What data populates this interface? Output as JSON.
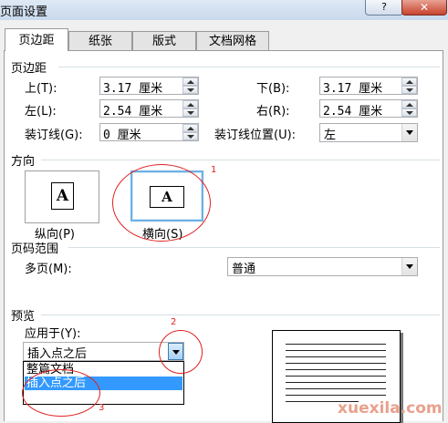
{
  "window": {
    "title": "页面设置",
    "help_glyph": "?",
    "close_glyph": "✕"
  },
  "tabs": [
    {
      "label": "页边距",
      "active": true
    },
    {
      "label": "纸张",
      "active": false
    },
    {
      "label": "版式",
      "active": false
    },
    {
      "label": "文档网格",
      "active": false
    }
  ],
  "margins": {
    "group_title": "页边距",
    "top_label": "上(T):",
    "top_value": "3.17 厘米",
    "bottom_label": "下(B):",
    "bottom_value": "3.17 厘米",
    "left_label": "左(L):",
    "left_value": "2.54 厘米",
    "right_label": "右(R):",
    "right_value": "2.54 厘米",
    "gutter_label": "装订线(G):",
    "gutter_value": "0 厘米",
    "gutter_pos_label": "装订线位置(U):",
    "gutter_pos_value": "左"
  },
  "orientation": {
    "group_title": "方向",
    "portrait_label": "纵向(P)",
    "landscape_label": "横向(S)",
    "glyph": "A",
    "selected": "landscape"
  },
  "pages": {
    "group_title": "页码范围",
    "multiple_label": "多页(M):",
    "multiple_value": "普通"
  },
  "preview": {
    "group_title": "预览",
    "apply_label": "应用于(Y):",
    "apply_value": "插入点之后",
    "apply_options": [
      "整篇文档",
      "插入点之后"
    ],
    "apply_selected_index": 1
  },
  "annotations": [
    "1",
    "2",
    "3"
  ],
  "watermark": "xuexila.com",
  "colors": {
    "annotation": "#e02020",
    "selection": "#3399ff",
    "watermark": "#e8a08c"
  }
}
